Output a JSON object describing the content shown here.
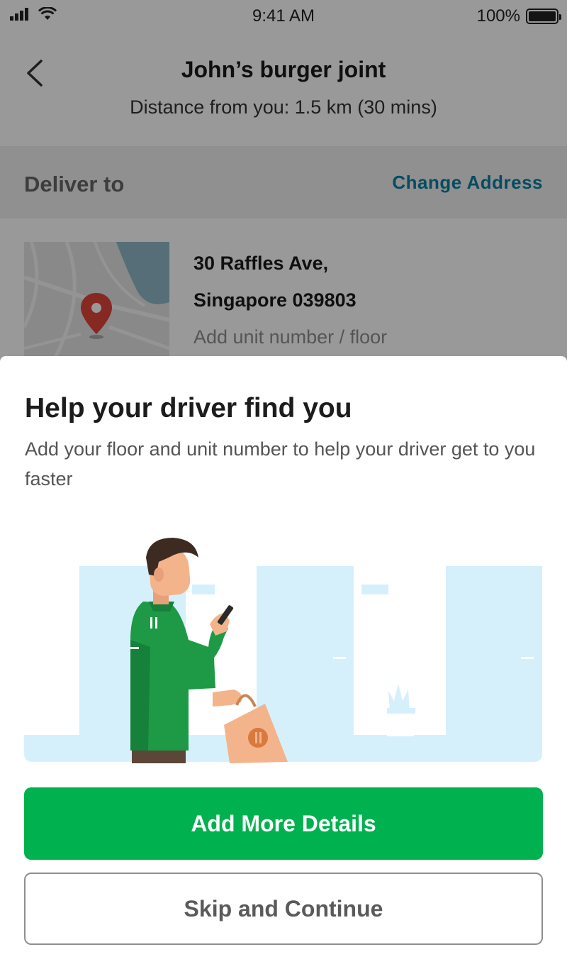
{
  "status_bar": {
    "time": "9:41 AM",
    "battery": "100%",
    "icons": [
      "signal-icon",
      "wifi-icon",
      "battery-icon"
    ]
  },
  "header": {
    "title": "John’s burger joint",
    "subtitle": "Distance from you: 1.5 km (30 mins)",
    "back_icon": "chevron-left-icon"
  },
  "delivery": {
    "label": "Deliver to",
    "change_address": "Change Address",
    "address_line1": "30 Raffles Ave,",
    "address_line2": "Singapore 039803",
    "unit_placeholder": "Add unit number / floor",
    "map_pin_icon": "map-pin-icon"
  },
  "sheet": {
    "title": "Help your driver find you",
    "description": "Add your floor and unit number to help your driver get to you faster",
    "primary_button": "Add More Details",
    "secondary_button": "Skip and Continue"
  },
  "colors": {
    "brand_green": "#00b14f",
    "link_blue": "#0a7fa0",
    "illustration_blue": "#d6f0fb"
  }
}
